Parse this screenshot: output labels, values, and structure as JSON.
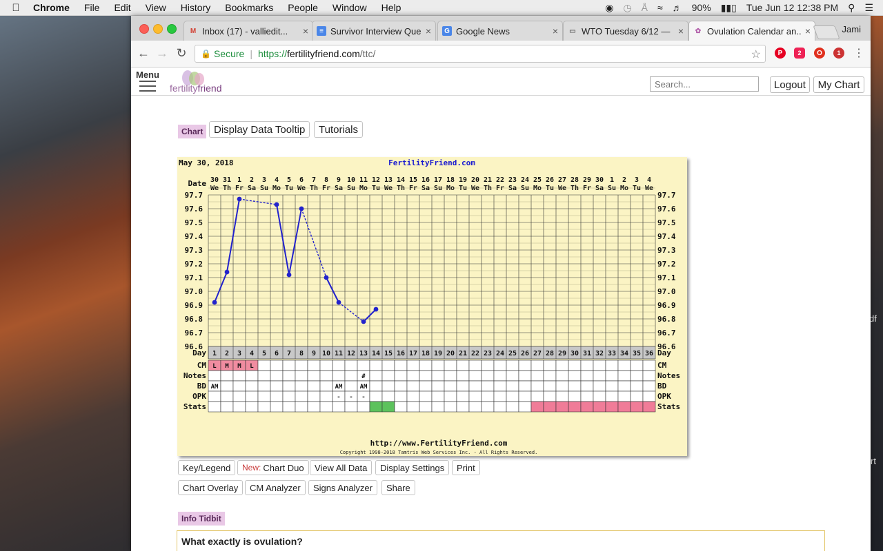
{
  "menubar": {
    "app": "Chrome",
    "items": [
      "File",
      "Edit",
      "View",
      "History",
      "Bookmarks",
      "People",
      "Window",
      "Help"
    ],
    "battery": "90%",
    "datetime": "Tue Jun 12  12:38 PM"
  },
  "desktop": {
    "text1": "df",
    "text2": "rt"
  },
  "browser": {
    "tabs": [
      {
        "title": "Inbox (17) - valliedit...",
        "favicon": "M"
      },
      {
        "title": "Survivor Interview Que...",
        "favicon": "≡"
      },
      {
        "title": "Google News",
        "favicon": "G"
      },
      {
        "title": "WTO Tuesday 6/12 —",
        "favicon": "▭"
      },
      {
        "title": "Ovulation Calendar an...",
        "favicon": "✿"
      }
    ],
    "profile": "Jami",
    "omnibox": {
      "secure": "Secure",
      "scheme": "https://",
      "host": "fertilityfriend.com",
      "path": "/ttc/"
    },
    "extensions": {
      "badge2": "2",
      "badge1": "1"
    }
  },
  "site": {
    "menu_label": "Menu",
    "logo_a": "fertility",
    "logo_b": "friend",
    "search_placeholder": "Search...",
    "logout": "Logout",
    "my_chart": "My Chart",
    "chart_pill": "Chart",
    "display_data_tooltip": "Display Data Tooltip",
    "tutorials": "Tutorials",
    "buttons_row1": {
      "key": "Key/Legend",
      "new": "New:",
      "duo": "Chart Duo",
      "view_all": "View All Data",
      "settings": "Display Settings",
      "print": "Print"
    },
    "buttons_row2": {
      "overlay": "Chart Overlay",
      "cm": "CM Analyzer",
      "signs": "Signs Analyzer",
      "share": "Share"
    },
    "info_pill": "Info Tidbit",
    "info_question": "What exactly is ovulation?"
  },
  "chart_data": {
    "type": "line",
    "start_date": "May 30, 2018",
    "site_title": "FertilityFriend.com",
    "footer_url": "http://www.FertilityFriend.com",
    "copyright": "Copyright 1998-2018 Tamtris Web Services Inc. - All Rights Reserved.",
    "dates": [
      "30",
      "31",
      "1",
      "2",
      "3",
      "4",
      "5",
      "6",
      "7",
      "8",
      "9",
      "10",
      "11",
      "12",
      "13",
      "14",
      "15",
      "16",
      "17",
      "18",
      "19",
      "20",
      "21",
      "22",
      "23",
      "24",
      "25",
      "26",
      "27",
      "28",
      "29",
      "30",
      "1",
      "2",
      "3",
      "4"
    ],
    "weekdays": [
      "We",
      "Th",
      "Fr",
      "Sa",
      "Su",
      "Mo",
      "Tu",
      "We",
      "Th",
      "Fr",
      "Sa",
      "Su",
      "Mo",
      "Tu",
      "We",
      "Th",
      "Fr",
      "Sa",
      "Su",
      "Mo",
      "Tu",
      "We",
      "Th",
      "Fr",
      "Sa",
      "Su",
      "Mo",
      "Tu",
      "We",
      "Th",
      "Fr",
      "Sa",
      "Su",
      "Mo",
      "Tu",
      "We"
    ],
    "y_ticks": [
      "97.7",
      "97.6",
      "97.5",
      "97.4",
      "97.3",
      "97.2",
      "97.1",
      "97.0",
      "96.9",
      "96.8",
      "96.7",
      "96.6"
    ],
    "ylim": [
      96.6,
      97.7
    ],
    "temps": [
      96.92,
      97.14,
      97.67,
      null,
      null,
      97.63,
      97.12,
      97.6,
      null,
      97.1,
      96.92,
      null,
      96.78,
      96.87
    ],
    "solid_segments": [
      [
        1,
        2
      ],
      [
        2,
        3
      ],
      [
        6,
        7
      ],
      [
        7,
        8
      ],
      [
        10,
        11
      ],
      [
        13,
        14
      ]
    ],
    "dashed_segments": [
      [
        3,
        6
      ],
      [
        8,
        10
      ],
      [
        11,
        13
      ]
    ],
    "row_labels": {
      "date": "Date",
      "day": "Day",
      "cm": "CM",
      "notes": "Notes",
      "bd": "BD",
      "opk": "OPK",
      "stats": "Stats"
    },
    "cm": [
      "L",
      "M",
      "M",
      "L"
    ],
    "notes": {
      "13": "#"
    },
    "bd": {
      "1": "AM",
      "11": "AM",
      "13": "AM"
    },
    "opk": {
      "11": "-",
      "12": "-",
      "13": "-"
    },
    "stats_green": [
      14,
      15
    ],
    "stats_pink_from": 27,
    "stats_pink_to": 36,
    "cm_color": "#f08ca0",
    "green": "#5cc25c",
    "pink": "#f07c98",
    "line_color": "#2222cc",
    "bg_color": "#fbf4c4"
  }
}
